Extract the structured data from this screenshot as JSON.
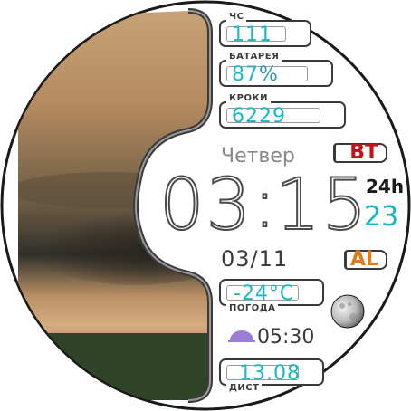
{
  "heart_rate": {
    "label": "ЧС",
    "value": "111"
  },
  "battery": {
    "label": "БАТАРЕЯ",
    "value": "87",
    "unit": "%"
  },
  "steps": {
    "label": "КРОКИ",
    "value": "6229"
  },
  "day_of_week": "Четвер",
  "bt_badge": "BT",
  "time": {
    "hours": "03",
    "separator": ":",
    "minutes": "15",
    "format": "24h",
    "seconds": "23"
  },
  "date": "03/11",
  "alarm_badge": "AL",
  "weather": {
    "value": "-24°C",
    "label": "ПОГОДА"
  },
  "sunset_time": "05:30",
  "distance": {
    "value": "13.08",
    "label": "ДИСТ"
  },
  "icons": {
    "moon": "moon-phase-icon",
    "sun": "sunset-icon"
  },
  "colors": {
    "accent": "#1ab8c4",
    "bt": "#c0141a",
    "alarm": "#e07a1a",
    "sun": "#9d7cd6",
    "frame": "#3a3a3a"
  }
}
